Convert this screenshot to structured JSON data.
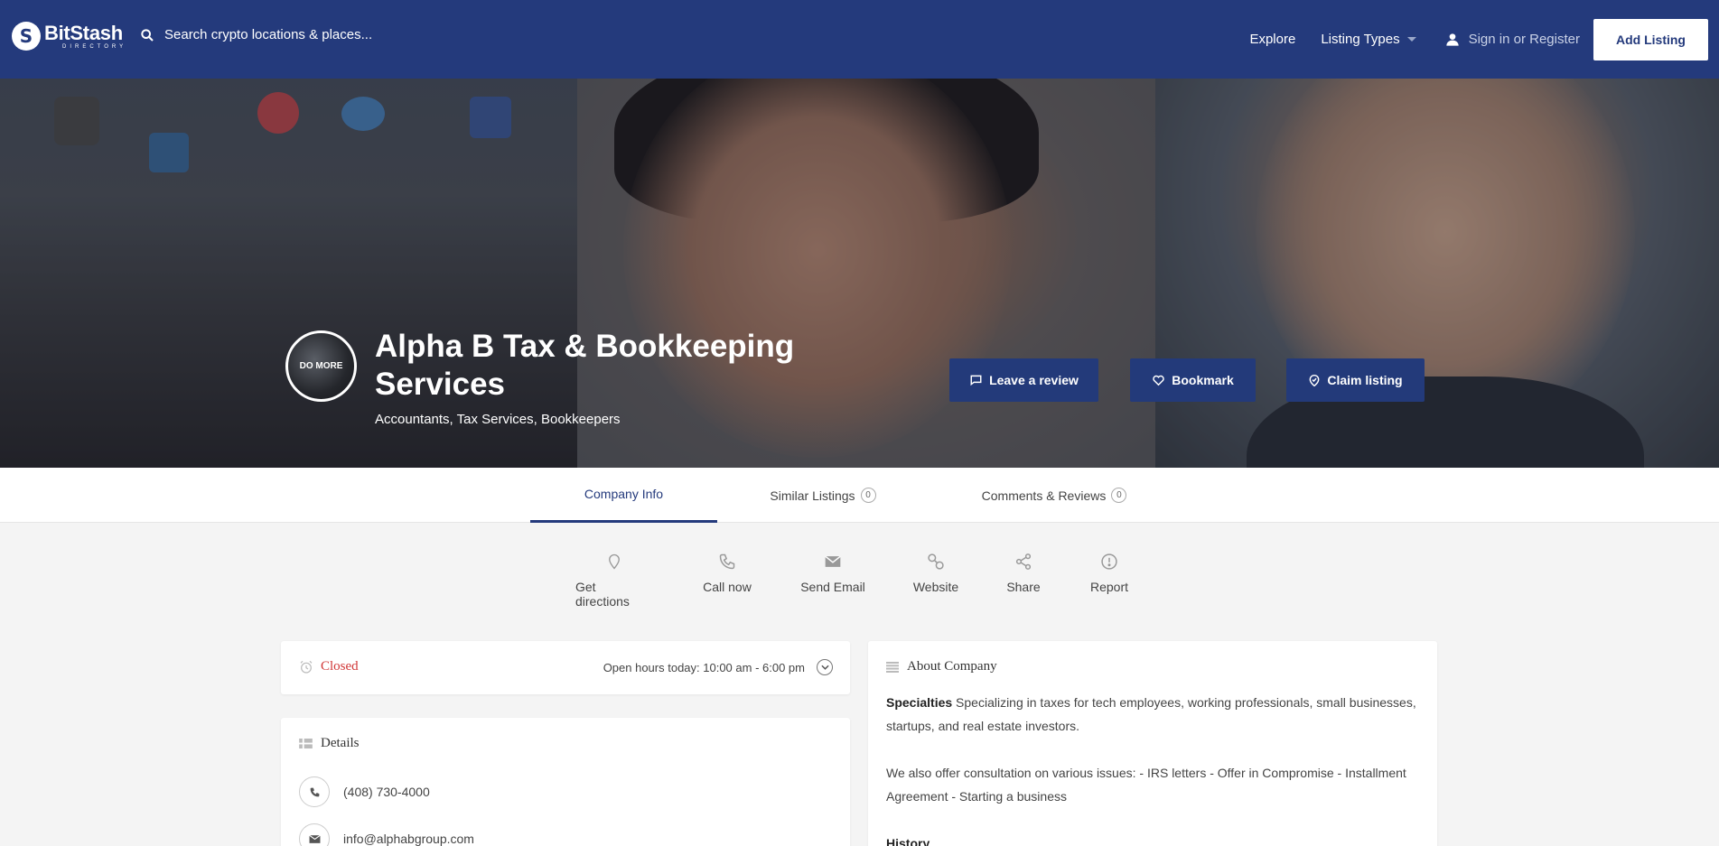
{
  "header": {
    "logo_name": "BitStash",
    "logo_sub": "DIRECTORY",
    "search_placeholder": "Search crypto locations & places...",
    "nav": {
      "explore": "Explore",
      "listing_types": "Listing Types",
      "sign_in": "Sign in or Register",
      "add_listing": "Add Listing"
    }
  },
  "listing": {
    "avatar_text": "DO MORE",
    "title": "Alpha B Tax & Bookkeeping Services",
    "categories": "Accountants, Tax Services, Bookkeepers",
    "actions": {
      "review": "Leave a review",
      "bookmark": "Bookmark",
      "claim": "Claim listing"
    }
  },
  "tabs": [
    {
      "label": "Company Info",
      "active": true
    },
    {
      "label": "Similar Listings",
      "count": "0"
    },
    {
      "label": "Comments & Reviews",
      "count": "0"
    }
  ],
  "quick_actions": {
    "directions": "Get directions",
    "call": "Call now",
    "email": "Send Email",
    "website": "Website",
    "share": "Share",
    "report": "Report"
  },
  "hours": {
    "status": "Closed",
    "open_today": "Open hours today: 10:00 am - 6:00 pm"
  },
  "details": {
    "title": "Details",
    "phone": "(408) 730-4000",
    "email": "info@alphabgroup.com"
  },
  "about": {
    "title": "About Company",
    "specialties_label": "Specialties",
    "specialties_text": "Specializing in taxes for tech employees, working professionals, small businesses, startups, and real estate investors.",
    "consultation": "We also offer consultation on various issues: - IRS letters - Offer in Compromise - Installment Agreement - Starting a business",
    "history_label": "History"
  },
  "colors": {
    "primary": "#243a7c",
    "closed": "#d13838",
    "background": "#f4f4f4"
  }
}
